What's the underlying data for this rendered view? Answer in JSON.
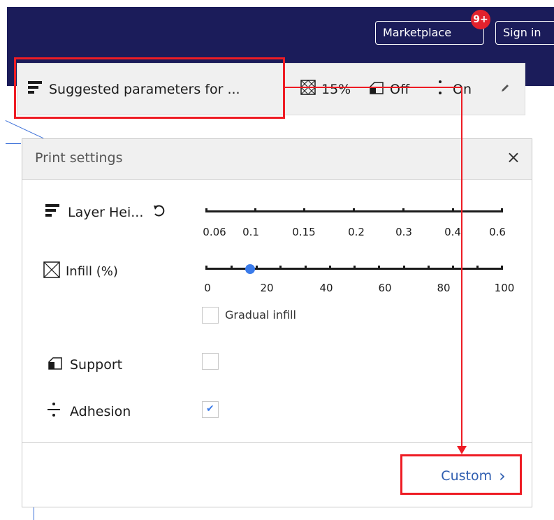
{
  "topbar": {
    "marketplace_label": "Marketplace",
    "marketplace_badge": "9+",
    "signin_label": "Sign in"
  },
  "quickbar": {
    "profile_label": "Suggested parameters for ...",
    "infill_value": "15%",
    "support_value": "Off",
    "adhesion_value": "On"
  },
  "print_settings": {
    "title": "Print settings",
    "close_label": "×",
    "layer_height": {
      "label": "Layer Hei...",
      "ticks": [
        "0.06",
        "0.1",
        "0.15",
        "0.2",
        "0.3",
        "0.4",
        "0.6"
      ]
    },
    "infill": {
      "label": "Infill (%)",
      "ticks": [
        "0",
        "20",
        "40",
        "60",
        "80",
        "100"
      ],
      "value_percent": 15,
      "gradual_label": "Gradual infill",
      "gradual_checked": false
    },
    "support": {
      "label": "Support",
      "checked": false
    },
    "adhesion": {
      "label": "Adhesion",
      "checked": true
    },
    "custom_button": "Custom",
    "custom_chevron": "›"
  },
  "colors": {
    "topbar": "#1b1c5a",
    "accent": "#3b7bea",
    "annotation": "#ee1c24",
    "badge": "#e2222d"
  },
  "icons": [
    "layer-height-icon",
    "infill-icon",
    "support-icon",
    "adhesion-icon",
    "edit-icon",
    "reset-icon",
    "close-icon",
    "chevron-right-icon"
  ]
}
